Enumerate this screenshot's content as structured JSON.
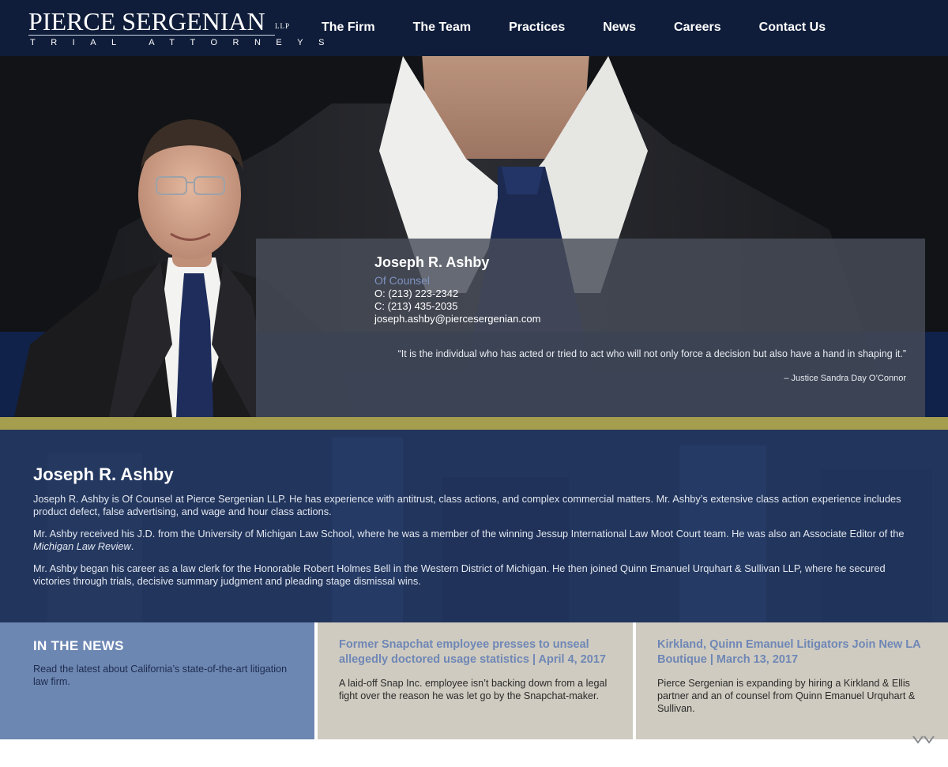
{
  "header": {
    "logo": {
      "name": "PIERCE SERGENIAN",
      "llp": "LLP",
      "tagline": "TRIAL ATTORNEYS"
    },
    "nav": [
      {
        "label": "The Firm"
      },
      {
        "label": "The Team"
      },
      {
        "label": "Practices"
      },
      {
        "label": "News"
      },
      {
        "label": "Careers"
      },
      {
        "label": "Contact Us"
      }
    ]
  },
  "profile": {
    "name": "Joseph R. Ashby",
    "title": "Of Counsel",
    "office_phone": "O: (213) 223-2342",
    "cell_phone": "C: (213) 435-2035",
    "email": "joseph.ashby@piercesergenian.com",
    "quote": "“It is the individual who has acted or tried to act who will not only force a decision but also have a hand in shaping it.”",
    "quote_attribution": "– Justice Sandra Day O’Connor"
  },
  "bio": {
    "heading": "Joseph R. Ashby",
    "p1": "Joseph R. Ashby is Of Counsel at Pierce Sergenian LLP. He has experience with antitrust, class actions, and complex commercial matters. Mr. Ashby’s extensive class action experience includes product defect, false advertising, and wage and hour class actions.",
    "p2_before": "Mr. Ashby received his J.D. from the University of Michigan Law School, where he was a member of the winning Jessup International Law Moot Court team. He was also an Associate Editor of the ",
    "p2_italic": "Michigan Law Review",
    "p2_after": ".",
    "p3": "Mr. Ashby began his career as a law clerk for the Honorable Robert Holmes Bell in the Western District of Michigan. He then joined Quinn Emanuel Urquhart & Sullivan LLP, where he secured victories through trials, decisive summary judgment and pleading stage dismissal wins."
  },
  "news": {
    "heading": "IN THE NEWS",
    "intro": "Read the latest about California’s state-of-the-art litigation law firm.",
    "items": [
      {
        "headline": "Former Snapchat employee presses to unseal allegedly doctored usage statistics | April 4, 2017",
        "summary": "A laid-off Snap Inc. employee isn’t backing down from a legal fight over the reason he was let go by the Snapchat-maker."
      },
      {
        "headline": "Kirkland, Quinn Emanuel Litigators Join New LA Boutique | March 13, 2017",
        "summary": "Pierce Sergenian is expanding by hiring a Kirkland & Ellis partner and an of counsel from Quinn Emanuel Urquhart & Sullivan."
      }
    ]
  },
  "colors": {
    "header_bg": "#0f1d3a",
    "hero_bg": "#121316",
    "accent_gold": "#a59e4f",
    "bio_bg": "#22355d",
    "news_intro_bg": "#6d87b3",
    "news_card_bg": "#cfcbc0",
    "link_blue": "#6f87b6"
  }
}
